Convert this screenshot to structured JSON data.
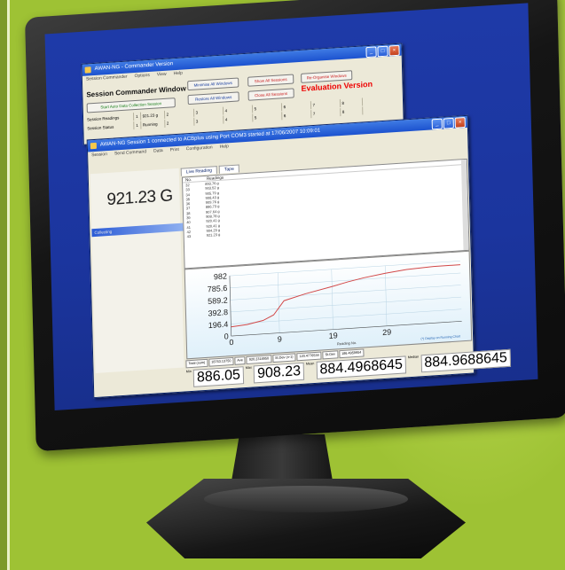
{
  "commander": {
    "title": "AWAN-NG - Commander Version",
    "menu": [
      "Session Commander",
      "Options",
      "View",
      "Help"
    ],
    "heading": "Session Commander Window",
    "buttons": [
      "Start Auto Data Collection Session",
      "Minimise All Windows",
      "Restore All Windows",
      "Show All Sessions",
      "Close All Sessions",
      "Re-Organise Windows"
    ],
    "evaluation": "Evaluation Version",
    "rows": [
      {
        "label": "Session Readings",
        "cells": [
          "1",
          "921.23 g",
          "2",
          "3",
          "4",
          "5",
          "6",
          "7",
          "8"
        ]
      },
      {
        "label": "Session Status",
        "cells": [
          "1",
          "Running",
          "2",
          "3",
          "4",
          "5",
          "6",
          "7",
          "8"
        ]
      }
    ]
  },
  "session": {
    "title": "AWAN-NG Session 1 connected to ACBplus using Port COM3 started at 17/06/2007 10:09:01",
    "menu": [
      "Session",
      "Send Command",
      "Data",
      "Print",
      "Configuration",
      "Help"
    ],
    "reading": "921.23 G",
    "status_label": "Collecting",
    "tabs": [
      "Live Reading",
      "Tape"
    ],
    "table_headers": [
      "No.",
      "Readings"
    ],
    "table_rows": [
      [
        "32",
        "893.76 g"
      ],
      [
        "33",
        "903.52 g"
      ],
      [
        "34",
        "905.79 g"
      ],
      [
        "35",
        "908.43 g"
      ],
      [
        "36",
        "909.76 g"
      ],
      [
        "37",
        "886.73 g"
      ],
      [
        "38",
        "907.64 g"
      ],
      [
        "39",
        "908.78 g"
      ],
      [
        "40",
        "920.41 g"
      ],
      [
        "41",
        "920.41 g"
      ],
      [
        "42",
        "904.29 g"
      ],
      [
        "43",
        "921.23 g"
      ]
    ],
    "chart_caption": "Reading No.",
    "chart_subcaption": "(*) Display on Running Chart",
    "status_fields": [
      "Total (sum)",
      "18763.13750",
      "Ave",
      "920.2318950",
      "St.Dev (n-1)",
      "120.4776534",
      "St.Dev",
      "186.4959954"
    ],
    "stats": [
      {
        "label": "Min",
        "value": "886.05"
      },
      {
        "label": "Max",
        "value": "908.23"
      },
      {
        "label": "Mean",
        "value": "884.4968645"
      },
      {
        "label": "Median",
        "value": "884.9688645"
      }
    ]
  },
  "chart_data": {
    "type": "line",
    "x": [
      0,
      3,
      6,
      8,
      10,
      14,
      19,
      22,
      25,
      29,
      33,
      38,
      43
    ],
    "values": [
      150,
      170,
      220,
      300,
      520,
      610,
      700,
      760,
      810,
      860,
      900,
      920,
      921
    ],
    "yticks": [
      "982",
      "785.6",
      "589.2",
      "392.8",
      "196.4",
      "0"
    ],
    "xticks": [
      "0",
      "9",
      "19",
      "29"
    ],
    "ylim": [
      0,
      982
    ],
    "xlim": [
      0,
      43
    ],
    "xlabel": "Reading No.",
    "colors": {
      "line": "#d24848"
    },
    "grid": true
  }
}
